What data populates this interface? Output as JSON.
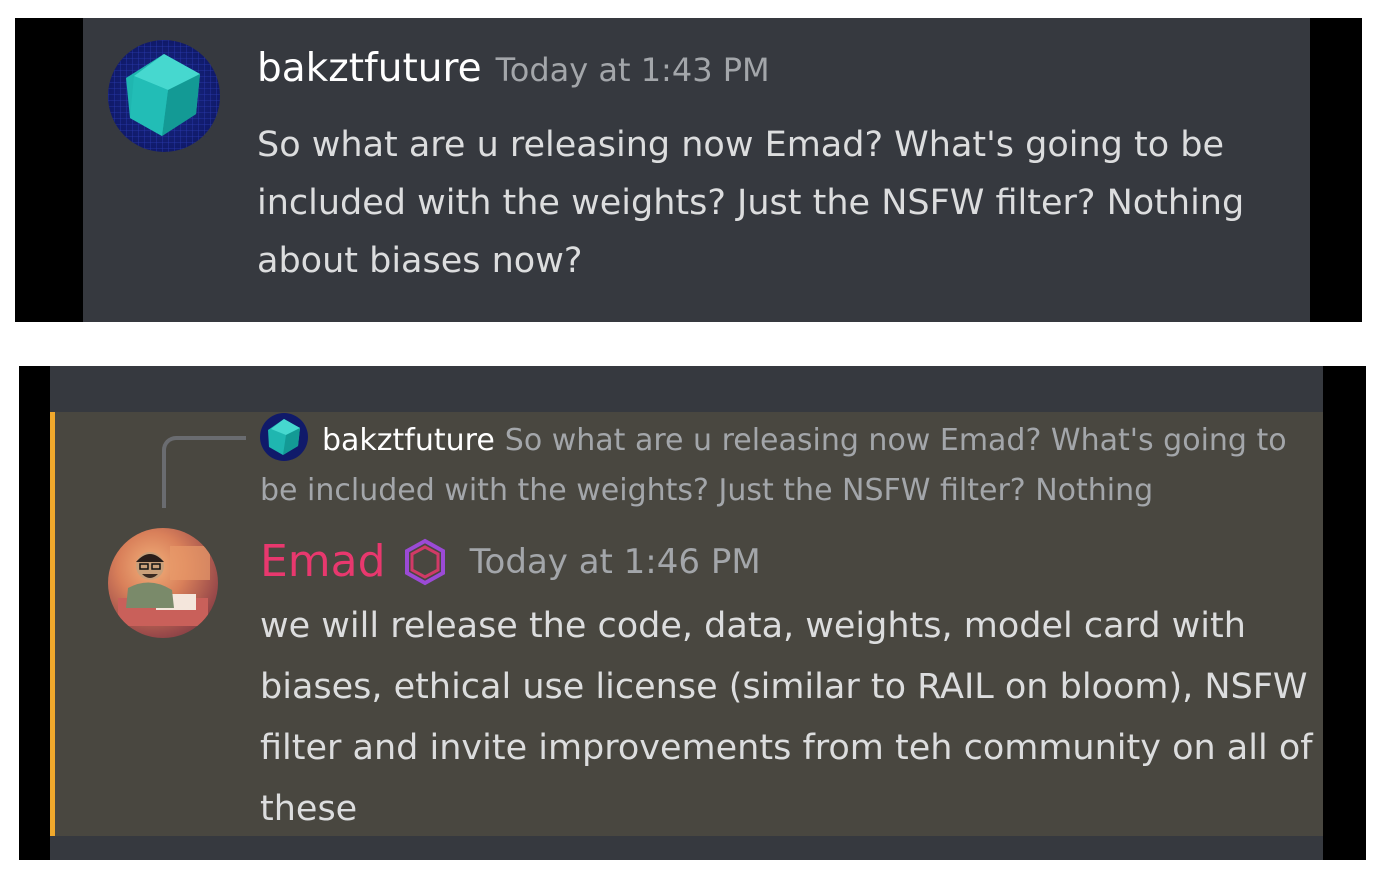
{
  "top_message": {
    "username": "bakztfuture",
    "timestamp": "Today at 1:43 PM",
    "content": "So what are u releasing now Emad?  What's going to be included with the weights?  Just the NSFW filter? Nothing about biases now?",
    "avatar_icon": "teal-cube-avatar"
  },
  "reply_message": {
    "replied_to": {
      "username": "bakztfuture",
      "preview": "So what are u releasing now Emad?  What's going to be included with the weights?  Just the NSFW filter? Nothing"
    },
    "username": "Emad",
    "username_color": "#e8386e",
    "timestamp": "Today at 1:46 PM",
    "content": "we will release the code, data, weights, model card with biases, ethical use license (similar to RAIL on bloom), NSFW filter and invite improvements from teh community on all of these",
    "highlight_color": "#f0a82c"
  }
}
